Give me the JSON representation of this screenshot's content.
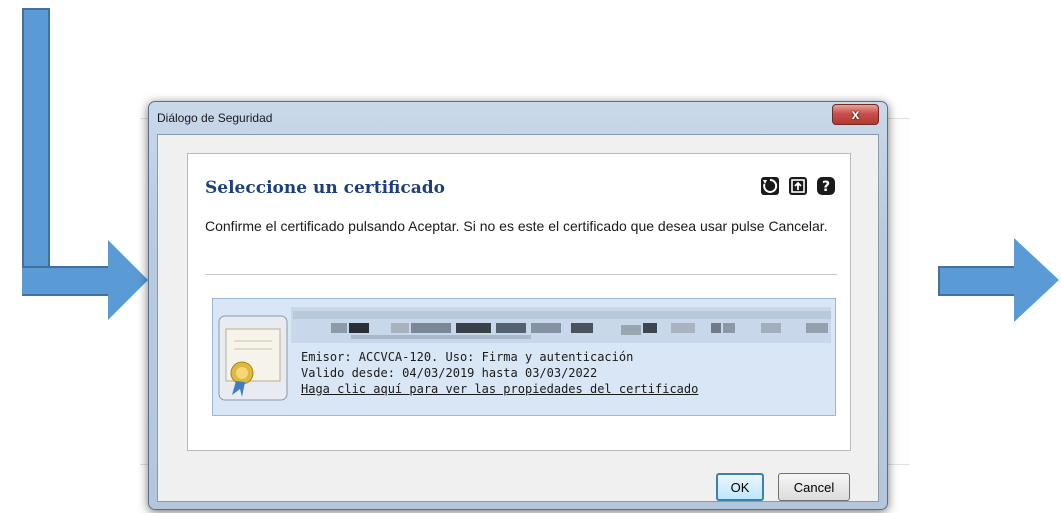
{
  "dialog": {
    "title": "Diálogo de Seguridad",
    "close_label": "x",
    "heading": "Seleccione un certificado",
    "message": "Confirme el certificado pulsando Aceptar. Si no es este el certificado que desea usar pulse Cancelar.",
    "tools": [
      {
        "icon": "refresh-icon"
      },
      {
        "icon": "import-icon"
      },
      {
        "icon": "help-icon"
      }
    ],
    "certificate": {
      "issuer_line": "Emisor: ACCVCA-120. Uso: Firma y autenticación",
      "validity_line": "Valido desde: 04/03/2019 hasta 03/03/2022",
      "properties_link": "Haga clic aquí para ver las propiedades del certificado"
    },
    "ok_label": "OK",
    "cancel_label": "Cancel"
  },
  "colors": {
    "arrow_fill": "#5b9bd5",
    "arrow_border": "#41719c",
    "heading": "#1d3f7a",
    "cert_background": "#d9e6f5"
  }
}
